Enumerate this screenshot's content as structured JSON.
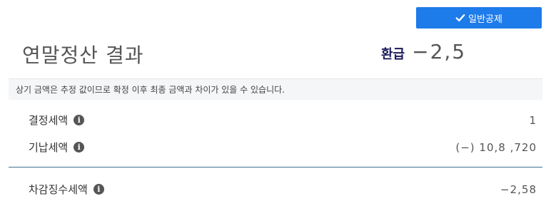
{
  "header": {
    "deduction_button_label": "일반공제",
    "page_title": "연말정산 결과",
    "refund_label": "환급",
    "refund_amount": "−2,5"
  },
  "notice": {
    "text": "상기 금액은 추정 값이므로 확정 이후 최종 금액과 차이가 있을 수 있습니다."
  },
  "rows": [
    {
      "label": "결정세액",
      "value": "1"
    },
    {
      "label": "기납세액",
      "value": "(−) 10,8 ,720"
    },
    {
      "label": "차감징수세액",
      "value": "−2,58"
    }
  ],
  "icons": {
    "check": "check-icon",
    "info": "info-icon"
  },
  "colors": {
    "accent": "#1d7bea",
    "title": "#555555",
    "refund_label": "#1b1b5a",
    "divider": "#3c6f8f",
    "notice_bg": "#f4f6f8"
  }
}
